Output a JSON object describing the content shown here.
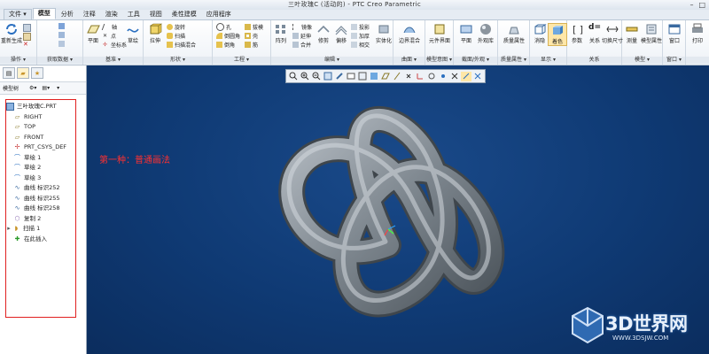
{
  "window": {
    "title": "三叶玫瑰C (活动的) - PTC Creo Parametric"
  },
  "menu_tabs": [
    {
      "label": "文件 ▾"
    },
    {
      "label": "模型"
    },
    {
      "label": "分析"
    },
    {
      "label": "注释"
    },
    {
      "label": "渲染"
    },
    {
      "label": "工具"
    },
    {
      "label": "视图"
    },
    {
      "label": "柔性建模"
    },
    {
      "label": "应用程序"
    }
  ],
  "ribbon": {
    "groups": [
      {
        "label": "操作 ▾"
      },
      {
        "label": "获取数据 ▾"
      },
      {
        "label": "基准 ▾"
      },
      {
        "label": "形状 ▾"
      },
      {
        "label": "工程 ▾"
      },
      {
        "label": "编辑 ▾"
      },
      {
        "label": "曲面 ▾"
      },
      {
        "label": "模型意图 ▾"
      },
      {
        "label": "截面/外观 ▾"
      },
      {
        "label": "质量属性 ▾"
      },
      {
        "label": "显示 ▾"
      },
      {
        "label": "关系"
      },
      {
        "label": "模型 ▾"
      },
      {
        "label": "窗口 ▾"
      },
      {
        "label": ""
      }
    ],
    "buttons": {
      "regenerate": "重新生成",
      "plane": "平面",
      "axis": "轴",
      "point": "点",
      "csys": "坐标系",
      "sketch": "草绘",
      "extrude": "拉伸",
      "revolve": "旋转",
      "sweep": "扫描",
      "swept_blend": "扫描混合",
      "hole": "孔",
      "round": "倒圆角",
      "chamfer": "倒角",
      "draft": "拔模",
      "shell": "壳",
      "rib": "筋",
      "pattern": "阵列",
      "mirror": "镜像",
      "trim": "修剪",
      "merge": "合并",
      "extend": "延伸",
      "offset": "偏移",
      "thicken": "加厚",
      "solidify": "实体化",
      "intersect": "相交",
      "project": "投影",
      "fill": "填充",
      "freestyle": "造型",
      "boundary": "边界混合",
      "component_interface": "元件界面",
      "plane2": "平面",
      "appearance": "外观库",
      "mass": "质量属性",
      "hide": "消隐",
      "shade": "着色",
      "params": "参数",
      "d_eq": "d=",
      "relations": "关系",
      "switch_dims": "切换尺寸",
      "measure": "测量",
      "model_props": "模型属性",
      "window": "窗口",
      "print": "打印"
    }
  },
  "left_panel": {
    "toolbar_label": "模型树",
    "tree": [
      {
        "label": "三叶玫瑰C.PRT",
        "icon": "part-icon"
      },
      {
        "label": "RIGHT",
        "icon": "datum-plane-icon"
      },
      {
        "label": "TOP",
        "icon": "datum-plane-icon"
      },
      {
        "label": "FRONT",
        "icon": "datum-plane-icon"
      },
      {
        "label": "PRT_CSYS_DEF",
        "icon": "csys-icon"
      },
      {
        "label": "草绘 1",
        "icon": "sketch-icon"
      },
      {
        "label": "草绘 2",
        "icon": "sketch-icon"
      },
      {
        "label": "草绘 3",
        "icon": "sketch-icon"
      },
      {
        "label": "曲线 标识252",
        "icon": "curve-icon"
      },
      {
        "label": "曲线 标识255",
        "icon": "curve-icon"
      },
      {
        "label": "曲线 标识258",
        "icon": "curve-icon"
      },
      {
        "label": "复制 2",
        "icon": "copy-icon"
      },
      {
        "label": "扫描 1",
        "icon": "sweep-icon"
      },
      {
        "label": "在此插入",
        "icon": "insert-here-icon"
      }
    ]
  },
  "viewport": {
    "annotation": "第一种：普通画法",
    "watermark_text": "3D世界网",
    "watermark_url": "WWW.3DSJW.COM",
    "background_color": "#0f3a74",
    "model_color": "#8a939b"
  }
}
